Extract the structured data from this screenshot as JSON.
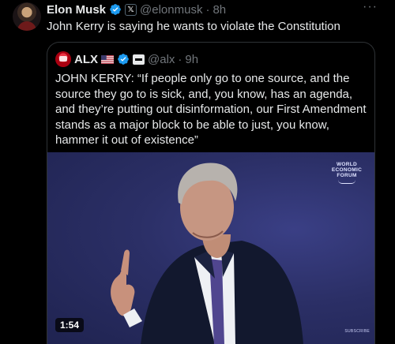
{
  "author": {
    "name": "Elon Musk",
    "handle": "@elonmusk",
    "separator": "·",
    "time": "8h",
    "affiliate_badge": "𝕏"
  },
  "tweet": {
    "text": "John Kerry is saying he wants to violate the Constitution"
  },
  "quote": {
    "author": {
      "name": "ALX",
      "handle": "@alx",
      "separator": "·",
      "time": "9h"
    },
    "text": "JOHN KERRY: “If people only go to one source, and the source they go to is sick, and, you know, has an agenda, and they’re putting out disinformation, our First Amendment stands as a major block to be able to just, you know, hammer it out of existence”",
    "media": {
      "overlay_logo": [
        "WORLD",
        "ECONOMIC",
        "FORUM"
      ],
      "corner_text": "SUBSCRIBE",
      "duration": "1:54"
    }
  },
  "icons": {
    "verified": "verified-badge-icon",
    "more": "more-options-icon",
    "flag": "us-flag-icon"
  },
  "colors": {
    "background": "#000000",
    "text": "#e7e9ea",
    "muted": "#71767b",
    "border": "#2f3336",
    "verified_blue": "#1d9bf0"
  }
}
